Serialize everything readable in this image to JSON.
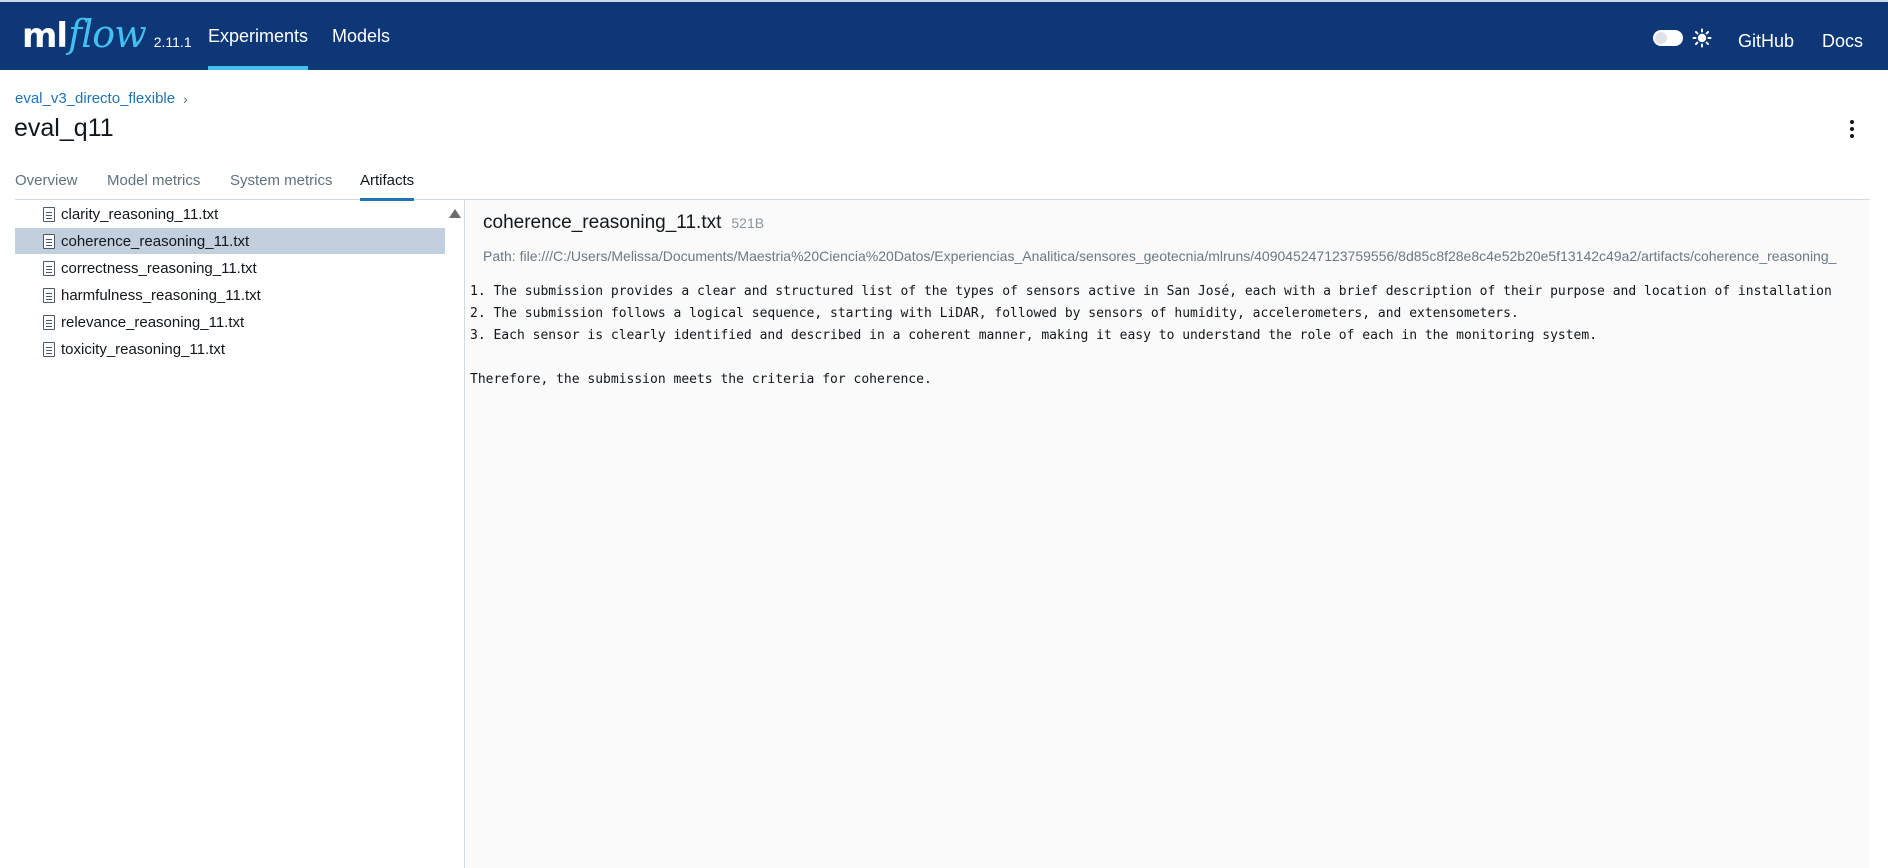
{
  "app": {
    "logo_ml": "ml",
    "logo_flow": "flow",
    "version": "2.11.1"
  },
  "nav": {
    "experiments": "Experiments",
    "models": "Models",
    "github": "GitHub",
    "docs": "Docs"
  },
  "breadcrumb": {
    "experiment": "eval_v3_directo_flexible",
    "chevron": "›"
  },
  "run": {
    "title": "eval_q11"
  },
  "tabs": [
    {
      "label": "Overview"
    },
    {
      "label": "Model metrics"
    },
    {
      "label": "System metrics"
    },
    {
      "label": "Artifacts",
      "active": true
    }
  ],
  "artifacts": {
    "files": [
      {
        "name": "clarity_reasoning_11.txt"
      },
      {
        "name": "coherence_reasoning_11.txt",
        "selected": true
      },
      {
        "name": "correctness_reasoning_11.txt"
      },
      {
        "name": "harmfulness_reasoning_11.txt"
      },
      {
        "name": "relevance_reasoning_11.txt"
      },
      {
        "name": "toxicity_reasoning_11.txt"
      }
    ],
    "preview": {
      "filename": "coherence_reasoning_11.txt",
      "size": "521B",
      "path": "Path: file:///C:/Users/Melissa/Documents/Maestria%20Ciencia%20Datos/Experiencias_Analitica/sensores_geotecnia/mlruns/409045247123759556/8d85c8f28e8c4e52b20e5f13142c49a2/artifacts/coherence_reasoning_",
      "content": "1. The submission provides a clear and structured list of the types of sensors active in San José, each with a brief description of their purpose and location of installation\n2. The submission follows a logical sequence, starting with LiDAR, followed by sensors of humidity, accelerometers, and extensometers.\n3. Each sensor is clearly identified and described in a coherent manner, making it easy to understand the role of each in the monitoring system.\n\nTherefore, the submission meets the criteria for coherence."
    }
  },
  "colors": {
    "header_bg": "#0e3778",
    "accent": "#43c0f0",
    "link": "#2272b4",
    "selected_row": "#c2cfdd"
  },
  "icons": [
    "sun-icon",
    "file-icon",
    "kebab-menu-icon",
    "chevron-right-icon"
  ]
}
